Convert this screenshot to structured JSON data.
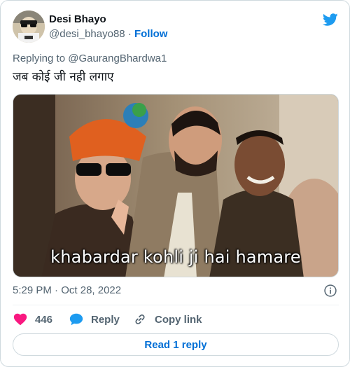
{
  "author": {
    "name": "Desi Bhayo",
    "handle": "@desi_bhayo88",
    "separator": "·",
    "follow_label": "Follow"
  },
  "brand_icon": "twitter-bird-icon",
  "replying": {
    "prefix": "Replying to ",
    "target": "@GaurangBhardwa1"
  },
  "tweet": {
    "text": "जब कोई जी नही लगाए"
  },
  "media": {
    "caption": "khabardar kohli ji hai hamare"
  },
  "meta": {
    "time": "5:29 PM",
    "separator": "·",
    "date": "Oct 28, 2022"
  },
  "actions": {
    "like_count": "446",
    "reply_label": "Reply",
    "copy_label": "Copy link"
  },
  "read_replies_label": "Read 1 reply",
  "colors": {
    "accent": "#006fd6",
    "like": "#f91880",
    "reply_icon": "#1d9bf0",
    "twitter_blue": "#1d9bf0",
    "muted": "#536471"
  }
}
